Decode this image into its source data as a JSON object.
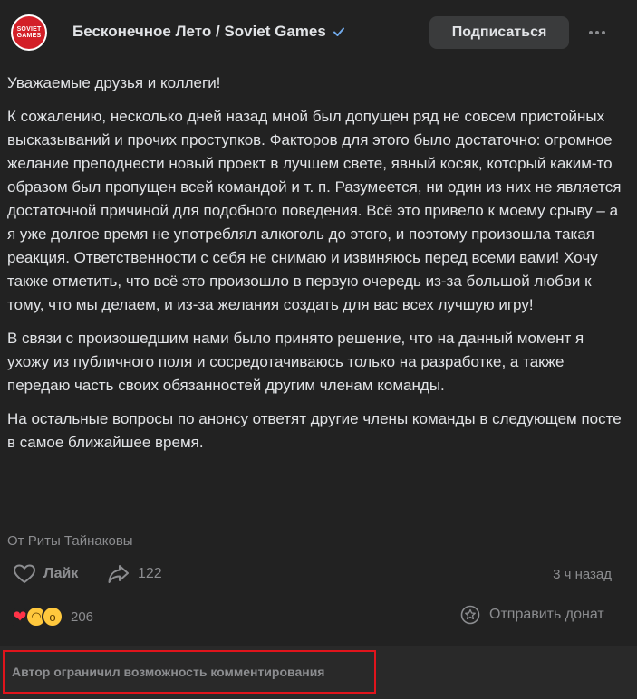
{
  "header": {
    "avatar_text": [
      "SOVIET",
      "GAMES"
    ],
    "author": "Бесконечное Лето / Soviet Games",
    "subscribe_label": "Подписаться"
  },
  "post": {
    "paragraphs": [
      "Уважаемые друзья и коллеги!",
      "К сожалению, несколько дней назад мной был допущен ряд не совсем пристойных высказываний и прочих проступков. Факторов для этого было достаточно: огромное желание преподнести новый проект в лучшем свете, явный косяк, который каким-то образом был пропущен всей командой и т. п. Разумеется, ни один из них не является достаточной причиной для подобного поведения. Всё это привело к моему срыву – а я уже долгое время не употреблял алкоголь до этого, и поэтому произошла такая реакция. Ответственности с себя не снимаю и извиняюсь перед всеми вами! Хочу также отметить, что всё это произошло в первую очередь из-за большой любви к тому, что мы делаем, и из-за желания создать для вас всех лучшую игру!",
      "В связи с произошедшим нами было принято решение, что на данный момент я ухожу из публичного поля и сосредотачиваюсь только на разработке, а также передаю часть своих обязанностей другим членам команды.",
      "На остальные вопросы по анонсу ответят другие члены команды в следующем посте в самое ближайшее время."
    ],
    "source": "От Риты Тайнаковы"
  },
  "actions": {
    "like_label": "Лайк",
    "share_count": "122",
    "time": "3 ч назад"
  },
  "reactions": {
    "count": "206",
    "donate_label": "Отправить донат"
  },
  "comments": {
    "restricted_text": "Автор ограничил возможность комментирования"
  },
  "colors": {
    "background": "#222222",
    "text": "#e1e3e6",
    "secondary": "#8c8d90",
    "verified": "#71aaeb",
    "highlight_border": "#e0141c"
  }
}
